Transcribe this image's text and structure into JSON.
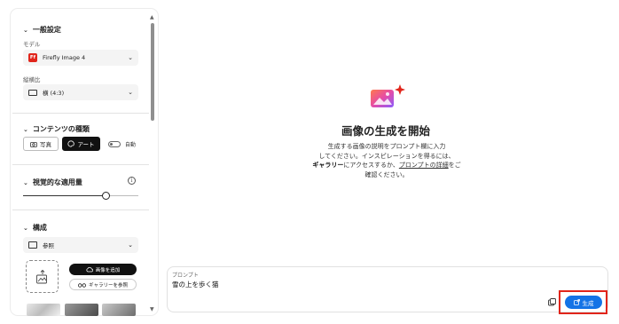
{
  "sidebar": {
    "general": {
      "title": "一般設定",
      "model_label": "モデル",
      "model_value": "Firefly Image 4",
      "model_logo": "Ff",
      "aspect_label": "縦横比",
      "aspect_value": "横 (4:3)"
    },
    "content_type": {
      "title": "コンテンツの種類",
      "photo_label": "写真",
      "art_label": "アート",
      "auto_label": "自動"
    },
    "visual_intensity": {
      "title": "視覚的な適用量",
      "info_icon": "i",
      "slider_level": 0.72
    },
    "composition": {
      "title": "構成",
      "reference_label": "参照",
      "add_image_label": "画像を追加",
      "gallery_label": "ギャラリーを参照"
    }
  },
  "main": {
    "title": "画像の生成を開始",
    "description_line1": "生成する画像の説明をプロンプト欄に入力",
    "description_line2": "してください。インスピレーションを得るには、",
    "description_gallery": "ギャラリー",
    "description_mid": "にアクセスするか、",
    "description_link": "プロンプトの詳細",
    "description_end": "をご",
    "description_line4": "確認ください。"
  },
  "prompt": {
    "label": "プロンプト",
    "value": "雪の上を歩く猫",
    "generate_label": "生成"
  },
  "colors": {
    "accent": "#1473e6",
    "highlight": "#e1251b",
    "firefly_logo": "#e1251b"
  }
}
